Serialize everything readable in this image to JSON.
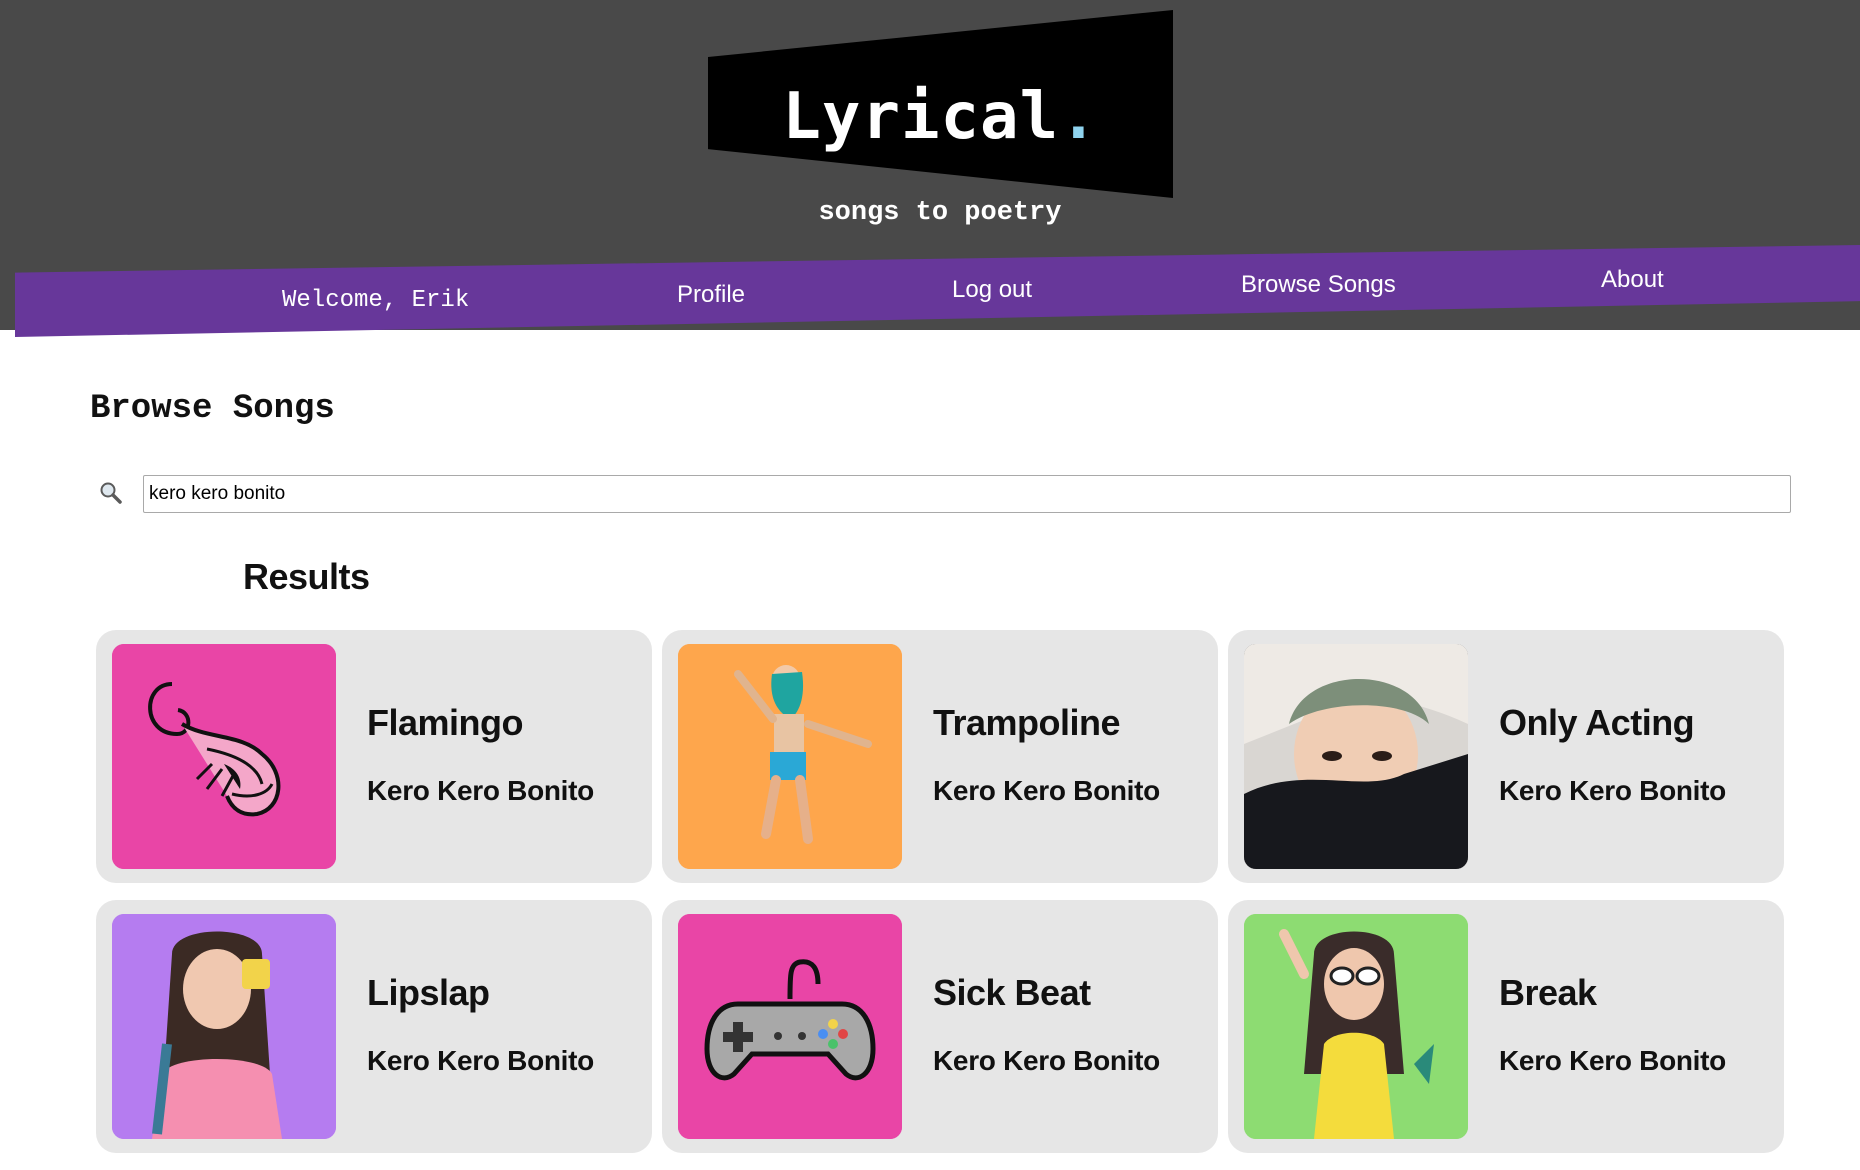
{
  "brand": {
    "logo_text": "Lyrical",
    "logo_dot": ".",
    "tagline": "songs to poetry"
  },
  "nav": {
    "welcome": "Welcome, Erik",
    "profile": "Profile",
    "logout": "Log out",
    "browse": "Browse Songs",
    "about": "About"
  },
  "page": {
    "title": "Browse Songs",
    "results_heading": "Results"
  },
  "search": {
    "value": "kero kero bonito",
    "icon": "search-icon"
  },
  "results": [
    {
      "title": "Flamingo",
      "artist": "Kero Kero Bonito",
      "art_color": "#e945a6",
      "art_icon": "shrimp-icon"
    },
    {
      "title": "Trampoline",
      "artist": "Kero Kero Bonito",
      "art_color": "#fea64c",
      "art_icon": "jumping-person-photo"
    },
    {
      "title": "Only Acting",
      "artist": "Kero Kero Bonito",
      "art_color": "#1b1c22",
      "art_icon": "portrait-photo"
    },
    {
      "title": "Lipslap",
      "artist": "Kero Kero Bonito",
      "art_color": "#b57cf0",
      "art_icon": "portrait-photo"
    },
    {
      "title": "Sick Beat",
      "artist": "Kero Kero Bonito",
      "art_color": "#e945a6",
      "art_icon": "gamepad-icon"
    },
    {
      "title": "Break",
      "artist": "Kero Kero Bonito",
      "art_color": "#8ddc72",
      "art_icon": "portrait-photo"
    }
  ],
  "colors": {
    "header_bg": "#494949",
    "nav_bg": "#67379a",
    "card_bg": "#e6e6e6",
    "accent_dot": "#8fd3ee"
  }
}
